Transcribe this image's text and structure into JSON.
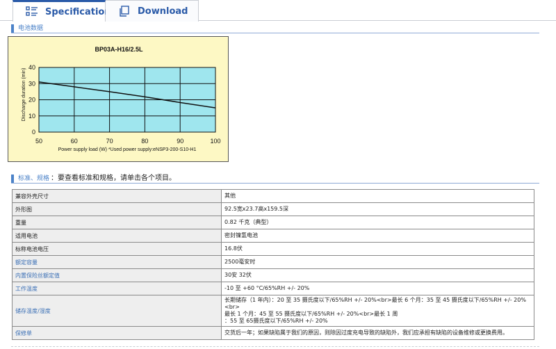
{
  "tabs": {
    "specification": "Specification",
    "download": "Download"
  },
  "section_battery": {
    "label": "电池数据"
  },
  "chart_data": {
    "type": "line",
    "title": "BP03A-H16/2.5L",
    "xlabel": "Power supply load (W)  *Used power supply:eNSP3-200-S10-H1",
    "ylabel": "Discharge duration (min)",
    "xlim": [
      50,
      100
    ],
    "ylim": [
      0,
      40
    ],
    "xticks": [
      50,
      60,
      70,
      80,
      90,
      100
    ],
    "yticks": [
      0,
      10,
      20,
      30,
      40
    ],
    "grid": true,
    "series": [
      {
        "x": [
          50,
          60,
          70,
          80,
          90,
          100
        ],
        "values": [
          31,
          28,
          25,
          21.8,
          18.3,
          15
        ]
      }
    ],
    "colors": {
      "plot_bg": "#9fe6ee",
      "frame_bg": "#fdf8c4",
      "line": "#111111"
    }
  },
  "section_spec": {
    "label": "标准、规格",
    "desc": "：要查看标准和规格，请单击各个项目。"
  },
  "spec_rows": [
    {
      "key": "兼容外壳尺寸",
      "value": "其他",
      "link": false
    },
    {
      "key": "外形图",
      "value": "92.5宽x23.7高x159.5深",
      "link": false
    },
    {
      "key": "重量",
      "value": "0.82 千克（典型）",
      "link": false
    },
    {
      "key": "适用电池",
      "value": "密封镍氢电池",
      "link": false
    },
    {
      "key": "标称电池电压",
      "value": "16.8伏",
      "link": false
    },
    {
      "key": "额定容量",
      "value": "2500毫安时",
      "link": true
    },
    {
      "key": "内置保险丝额定值",
      "value": "30安 32伏",
      "link": true
    },
    {
      "key": "工作温度",
      "value": "-10 至 +60 °C/65%RH +/- 20%",
      "link": true
    },
    {
      "key": "储存温度/湿度",
      "value_lines": [
        "长期储存（1 年内）：20 至 35 摄氏度以下/65%RH +/- 20%<br>最长 6 个月：35 至 45 摄氏度以下/65%RH +/- 20%<br>",
        "最长 1 个月：45 至 55 摄氏度以下/65%RH +/- 20%<br>最长 1 周",
        "：55 至 65摄氏度以下/65%RH +/- 20%"
      ],
      "link": true
    },
    {
      "key": "保修单",
      "value": "交货后一年；如果缺陷属于我们的原因，则除因过度充电导致的缺陷外，我们应承担有缺陷的设备维修或更换费用。",
      "link": true
    }
  ]
}
